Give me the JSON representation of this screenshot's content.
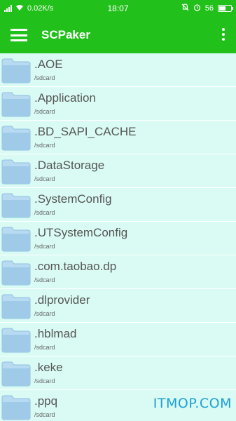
{
  "status_bar": {
    "network_speed": "0.02K/s",
    "time": "18:07",
    "battery_level": "56",
    "battery_fraction": 0.56
  },
  "app_bar": {
    "title": "SCPaker"
  },
  "files": [
    {
      "name": ".AOE",
      "path": "/sdcard"
    },
    {
      "name": ".Application",
      "path": "/sdcard"
    },
    {
      "name": ".BD_SAPI_CACHE",
      "path": "/sdcard"
    },
    {
      "name": ".DataStorage",
      "path": "/sdcard"
    },
    {
      "name": ".SystemConfig",
      "path": "/sdcard"
    },
    {
      "name": ".UTSystemConfig",
      "path": "/sdcard"
    },
    {
      "name": ".com.taobao.dp",
      "path": "/sdcard"
    },
    {
      "name": ".dlprovider",
      "path": "/sdcard"
    },
    {
      "name": ".hblmad",
      "path": "/sdcard"
    },
    {
      "name": ".keke",
      "path": "/sdcard"
    },
    {
      "name": ".ppq",
      "path": "/sdcard"
    }
  ],
  "watermark": "ITMOP.COM",
  "colors": {
    "accent": "#22c01a",
    "list_background": "#d9fbf3",
    "folder": "#9fcbe9",
    "watermark": "#1f9fd6"
  }
}
